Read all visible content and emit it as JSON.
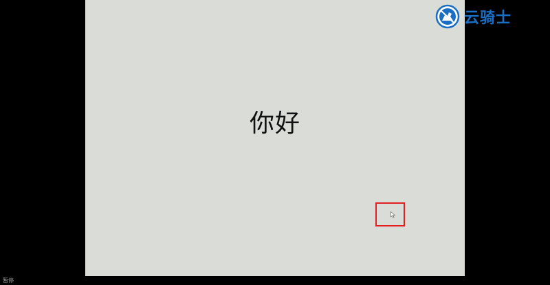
{
  "slide": {
    "text": "你好"
  },
  "watermark": {
    "text": "云骑士",
    "color": "#1a6fc4"
  },
  "status": {
    "label": "暂停"
  },
  "colors": {
    "slide_background": "#d9dcd7",
    "outer_background": "#000000",
    "highlight": "#e02020"
  }
}
